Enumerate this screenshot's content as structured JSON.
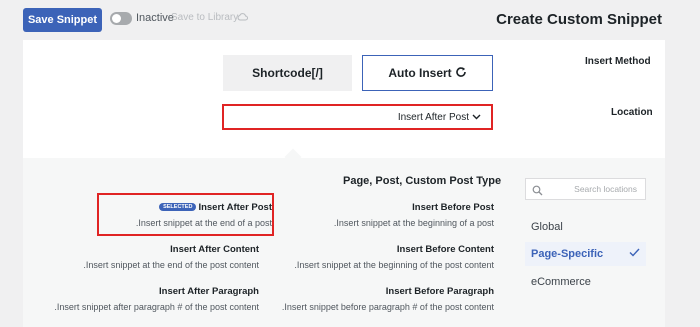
{
  "header": {
    "save_button": "Save Snippet",
    "toggle_label": "Inactive",
    "save_library": "Save to Library",
    "title": "Create Custom Snippet"
  },
  "insert_method": {
    "label": "Insert Method",
    "options": [
      {
        "label": "Shortcode[/]",
        "selected": false
      },
      {
        "label": "Auto Insert",
        "selected": true
      }
    ]
  },
  "location": {
    "label": "Location",
    "current": "Insert After Post"
  },
  "dropdown": {
    "search_placeholder": "Search locations",
    "group_title": "Page, Post, Custom Post Type",
    "selected_badge": "SELECTED",
    "options": [
      {
        "title": "Insert After Post",
        "desc": ".Insert snippet at the end of a post",
        "selected": true
      },
      {
        "title": "Insert Before Post",
        "desc": ".Insert snippet at the beginning of a post",
        "selected": false
      },
      {
        "title": "Insert After Content",
        "desc": ".Insert snippet at the end of the post content",
        "selected": false
      },
      {
        "title": "Insert Before Content",
        "desc": ".Insert snippet at the beginning of the post content",
        "selected": false
      },
      {
        "title": "Insert After Paragraph",
        "desc": ".Insert snippet after paragraph # of the post content",
        "selected": false
      },
      {
        "title": "Insert Before Paragraph",
        "desc": ".Insert snippet before paragraph # of the post content",
        "selected": false
      }
    ],
    "categories": [
      {
        "label": "Global",
        "active": false
      },
      {
        "label": "Page-Specific",
        "active": true
      },
      {
        "label": "eCommerce",
        "active": false
      }
    ]
  },
  "colors": {
    "accent": "#3c63b8",
    "highlight": "#e02424"
  }
}
